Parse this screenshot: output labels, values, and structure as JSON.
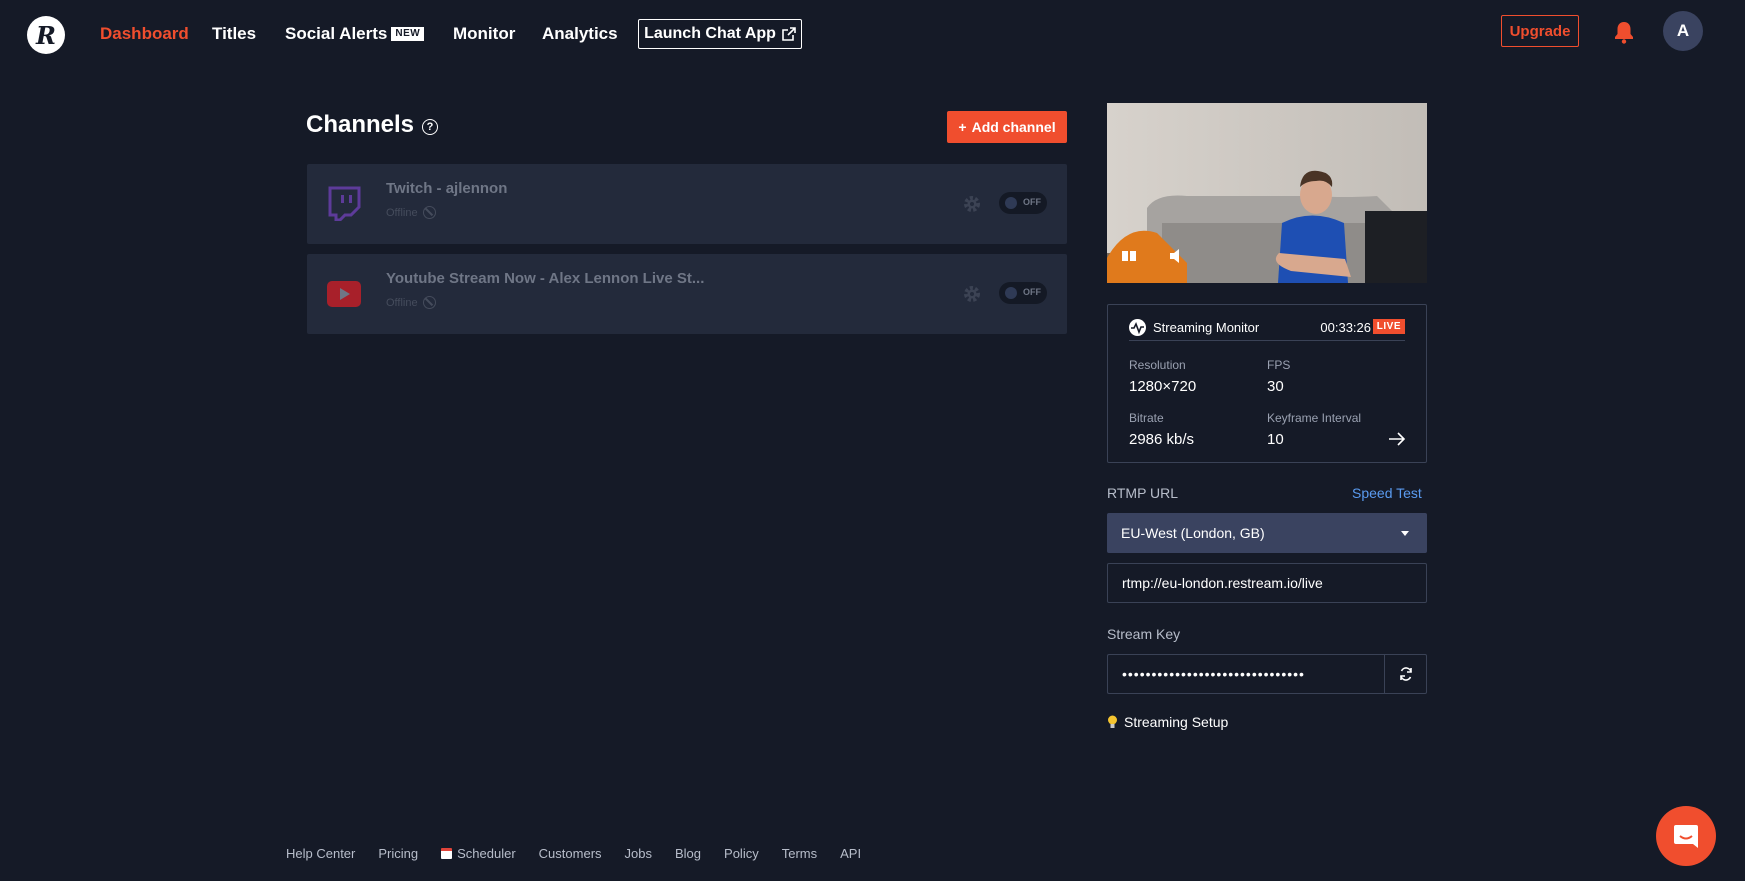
{
  "nav": {
    "logo": "R",
    "items": [
      {
        "label": "Dashboard"
      },
      {
        "label": "Titles"
      },
      {
        "label": "Social Alerts",
        "badge": "NEW"
      },
      {
        "label": "Monitor"
      },
      {
        "label": "Analytics"
      }
    ],
    "launch_chat": "Launch Chat App",
    "upgrade": "Upgrade",
    "avatar_initial": "A",
    "active_color": "#f04e2e"
  },
  "channels": {
    "title": "Channels",
    "help": "?",
    "add_button": "Add channel",
    "add_icon": "+",
    "list": [
      {
        "name": "Twitch - ajlennon",
        "status": "Offline",
        "toggle": "OFF",
        "icon": "twitch-icon",
        "color": "#5d3b9a"
      },
      {
        "name": "Youtube Stream Now - Alex Lennon Live St...",
        "status": "Offline",
        "toggle": "OFF",
        "icon": "youtube-icon",
        "color": "#a8202a"
      }
    ]
  },
  "monitor": {
    "title": "Streaming Monitor",
    "time": "00:33:26",
    "live": "LIVE",
    "resolution_label": "Resolution",
    "resolution": "1280×720",
    "fps_label": "FPS",
    "fps": "30",
    "bitrate_label": "Bitrate",
    "bitrate": "2986 kb/s",
    "keyframe_label": "Keyframe Interval",
    "keyframe": "10"
  },
  "rtmp": {
    "label": "RTMP URL",
    "speed_test": "Speed Test",
    "server": "EU-West (London, GB)",
    "url": "rtmp://eu-london.restream.io/live"
  },
  "stream_key": {
    "label": "Stream Key",
    "value": "•••••••••••••••••••••••••••••••"
  },
  "setup": "Streaming Setup",
  "footer": {
    "links": [
      "Help Center",
      "Pricing",
      "Scheduler",
      "Customers",
      "Jobs",
      "Blog",
      "Policy",
      "Terms",
      "API"
    ]
  }
}
